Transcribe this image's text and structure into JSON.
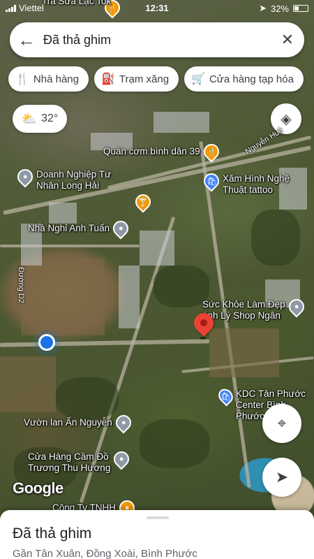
{
  "status_bar": {
    "carrier": "Viettel",
    "time": "12:31",
    "battery": "32%"
  },
  "search": {
    "title": "Đã thả ghim"
  },
  "chips": [
    {
      "label": "Nhà hàng",
      "icon": "fork-knife-icon"
    },
    {
      "label": "Trạm xăng",
      "icon": "gas-station-icon"
    },
    {
      "label": "Cửa hàng tạp hóa",
      "icon": "cart-icon"
    }
  ],
  "weather": {
    "temperature": "32°",
    "icon": "partly-cloudy-icon"
  },
  "map": {
    "pois": [
      {
        "label": "Tra Sữa Lạc Tok",
        "type": "orange"
      },
      {
        "label": "Quán cơm bình dân 39",
        "type": "orange"
      },
      {
        "label": "Doanh Nghiệp Tư\nNhân Long Hải",
        "type": "gray"
      },
      {
        "label": "Xăm Hình Nghệ\nThuật tattoo",
        "type": "blue"
      },
      {
        "label": "Nhà Nghỉ Anh Tuấn",
        "type": "gray"
      },
      {
        "label": "Sức Khỏe Làm Đẹp\nánh Lý Shop Ngân",
        "type": "gray"
      },
      {
        "label": "KDC Tân Phước\nCenter Bình Phước 65",
        "type": "blue"
      },
      {
        "label": "Vườn lan Ấn Nguyễn",
        "type": "gray"
      },
      {
        "label": "Cửa Hàng Cầm Đồ\nTrương Thu Hương",
        "type": "gray"
      },
      {
        "label": "Công Ty TNHH",
        "type": "orange"
      }
    ],
    "streets": [
      {
        "label": "Nguyễn Huệ"
      },
      {
        "label": "Đường D2"
      }
    ],
    "logo": "Google"
  },
  "bottom_sheet": {
    "title": "Đã thả ghim",
    "subtitle": "Gần Tân Xuân, Đồng Xoài, Bình Phước"
  },
  "colors": {
    "dropped_pin": "#ea4335",
    "location_dot": "#1a73e8",
    "poi_gray": "#8e9aa6",
    "poi_orange": "#f29900",
    "poi_blue": "#4285f4"
  }
}
